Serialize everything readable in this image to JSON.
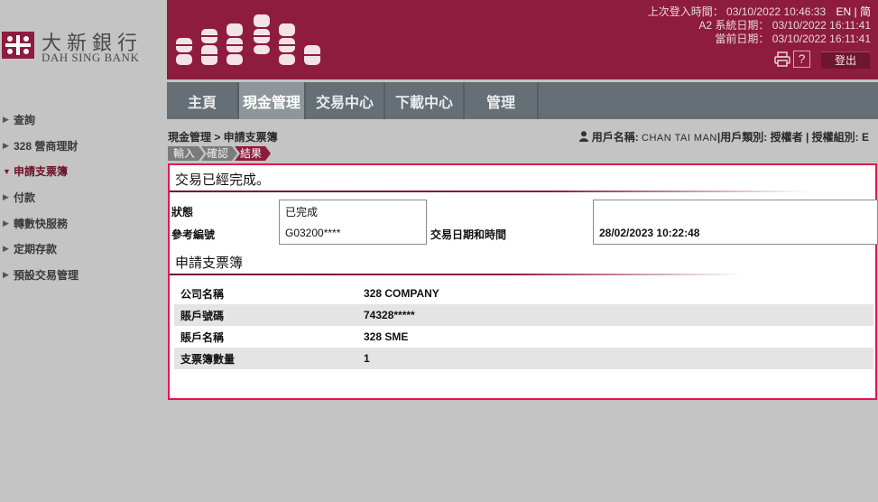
{
  "brand": {
    "name_zh": "大新銀行",
    "name_en": "DAH SING BANK"
  },
  "header": {
    "last_login_label": "上次登入時間：",
    "last_login_value": "03/10/2022 10:46:33",
    "lang_en": "EN",
    "lang_sep": "|",
    "lang_zh": "简",
    "system_date_label": "A2 系統日期：",
    "system_date_value": "03/10/2022 16:11:41",
    "current_date_label": "當前日期：",
    "current_date_value": "03/10/2022 16:11:41",
    "help_label": "?",
    "logout_label": "登出"
  },
  "nav": [
    {
      "label": "主頁",
      "active": false
    },
    {
      "label": "現金管理",
      "active": true
    },
    {
      "label": "交易中心",
      "active": false
    },
    {
      "label": "下載中心",
      "active": false
    },
    {
      "label": "管理",
      "active": false
    }
  ],
  "sidebar": [
    {
      "label": "查詢",
      "active": false
    },
    {
      "label": "328 營商理財",
      "active": false
    },
    {
      "label": "申請支票簿",
      "active": true
    },
    {
      "label": "付款",
      "active": false
    },
    {
      "label": "轉數快服務",
      "active": false
    },
    {
      "label": "定期存款",
      "active": false
    },
    {
      "label": "預設交易管理",
      "active": false
    }
  ],
  "breadcrumb": "現金管理 > 申請支票簿",
  "user": {
    "name_label": "用戶名稱:",
    "name_value": "CHAN TAI MAN",
    "sep1": "|",
    "type_label": "用戶類別:",
    "type_value": "授權者",
    "sep2": "|",
    "group_label": "授權組別:",
    "group_value": "E"
  },
  "steps": [
    "輸入",
    "確認",
    "結果"
  ],
  "result": {
    "message": "交易已經完成。",
    "status_label": "狀態",
    "status_value": "已完成",
    "ref_label": "參考編號",
    "ref_value": "G03200****",
    "datetime_label": "交易日期和時間",
    "datetime_value": "28/02/2023 10:22:48",
    "section_title": "申請支票簿",
    "rows": [
      {
        "label": "公司名稱",
        "value": "328 COMPANY"
      },
      {
        "label": "賬戶號碼",
        "value": "74328*****"
      },
      {
        "label": "賬戶名稱",
        "value": "328 SME"
      },
      {
        "label": "支票簿數量",
        "value": "1"
      }
    ]
  },
  "colors": {
    "brand": "#8e1c3e",
    "nav_bg": "#666f75",
    "nav_active": "#8d969b",
    "panel_border": "#e3184a",
    "page_bg": "#c4c4c4"
  }
}
